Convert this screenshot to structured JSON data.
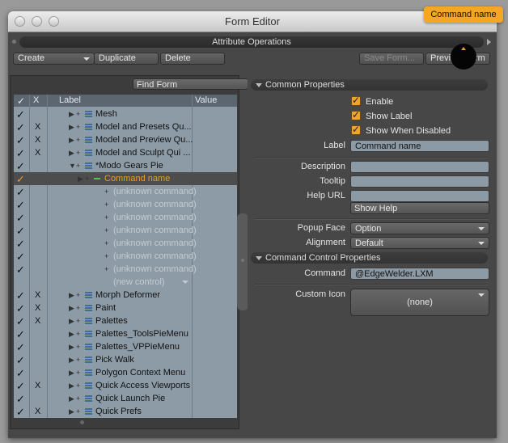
{
  "window": {
    "title": "Form Editor"
  },
  "tooltip": "Command name",
  "attr_bar": "Attribute Operations",
  "toolbar": {
    "create": "Create",
    "duplicate": "Duplicate",
    "delete": "Delete",
    "save_form": "Save Form...",
    "preview_form": "Preview Form"
  },
  "find_form": "Find Form",
  "tree": {
    "headers": {
      "check": "✓",
      "x": "X",
      "label": "Label",
      "value": "Value"
    },
    "rows": [
      {
        "label": "Mesh",
        "x": "",
        "check": "✓",
        "style": "normal",
        "icon": "list-icon"
      },
      {
        "label": "Model and Presets Qu...",
        "x": "X",
        "check": "✓",
        "style": "normal",
        "icon": "list-icon"
      },
      {
        "label": "Model and Preview Qu...",
        "x": "X",
        "check": "✓",
        "style": "normal",
        "icon": "list-icon"
      },
      {
        "label": "Model and Sculpt Qui ...",
        "x": "X",
        "check": "✓",
        "style": "normal",
        "icon": "list-icon"
      },
      {
        "label": "*Modo Gears Pie",
        "x": "",
        "check": "✓",
        "style": "normal",
        "icon": "list-icon"
      },
      {
        "label": "Command name",
        "x": "",
        "check": "✓",
        "style": "selected",
        "icon": "command-icon"
      },
      {
        "label": "(unknown command)",
        "x": "",
        "check": "✓",
        "style": "gray",
        "icon": "none"
      },
      {
        "label": "(unknown command)",
        "x": "",
        "check": "✓",
        "style": "gray",
        "icon": "none"
      },
      {
        "label": "(unknown command)",
        "x": "",
        "check": "✓",
        "style": "gray",
        "icon": "none"
      },
      {
        "label": "(unknown command)",
        "x": "",
        "check": "✓",
        "style": "gray",
        "icon": "none"
      },
      {
        "label": "(unknown command)",
        "x": "",
        "check": "✓",
        "style": "gray",
        "icon": "none"
      },
      {
        "label": "(unknown command)",
        "x": "",
        "check": "✓",
        "style": "gray",
        "icon": "none"
      },
      {
        "label": "(unknown command)",
        "x": "",
        "check": "✓",
        "style": "gray",
        "icon": "none"
      },
      {
        "label": "(new control)",
        "x": "",
        "check": "",
        "style": "newctl",
        "icon": "none"
      },
      {
        "label": "Morph Deformer",
        "x": "X",
        "check": "✓",
        "style": "normal",
        "icon": "list-icon"
      },
      {
        "label": "Paint",
        "x": "X",
        "check": "✓",
        "style": "normal",
        "icon": "list-icon"
      },
      {
        "label": "Palettes",
        "x": "X",
        "check": "✓",
        "style": "normal",
        "icon": "list-icon"
      },
      {
        "label": "Palettes_ToolsPieMenu",
        "x": "",
        "check": "✓",
        "style": "normal",
        "icon": "list-icon"
      },
      {
        "label": "Palettes_VPPieMenu",
        "x": "",
        "check": "✓",
        "style": "normal",
        "icon": "list-icon"
      },
      {
        "label": "Pick Walk",
        "x": "",
        "check": "✓",
        "style": "normal",
        "icon": "list-icon"
      },
      {
        "label": "Polygon Context Menu",
        "x": "",
        "check": "✓",
        "style": "normal",
        "icon": "list-icon"
      },
      {
        "label": "Quick Access Viewports",
        "x": "X",
        "check": "✓",
        "style": "normal",
        "icon": "list-icon"
      },
      {
        "label": "Quick Launch Pie",
        "x": "",
        "check": "✓",
        "style": "normal",
        "icon": "list-icon"
      },
      {
        "label": "Quick Prefs",
        "x": "X",
        "check": "✓",
        "style": "normal",
        "icon": "list-icon"
      }
    ]
  },
  "common": {
    "title": "Common Properties",
    "enable": "Enable",
    "show_label": "Show Label",
    "show_when_disabled": "Show When Disabled",
    "label_label": "Label",
    "label_value": "Command name",
    "description_label": "Description",
    "description_value": "",
    "tooltip_label": "Tooltip",
    "tooltip_value": "",
    "helpurl_label": "Help URL",
    "helpurl_value": "",
    "show_help": "Show Help",
    "popup_face_label": "Popup Face",
    "popup_face_value": "Option",
    "alignment_label": "Alignment",
    "alignment_value": "Default"
  },
  "command_props": {
    "title": "Command Control Properties",
    "command_label": "Command",
    "command_value": "@EdgeWelder.LXM",
    "custom_icon_label": "Custom Icon",
    "custom_icon_value": "(none)"
  },
  "colors": {
    "accent": "#f0a42d",
    "tree_bg": "#8d9ba6",
    "panel_bg": "#474747"
  }
}
